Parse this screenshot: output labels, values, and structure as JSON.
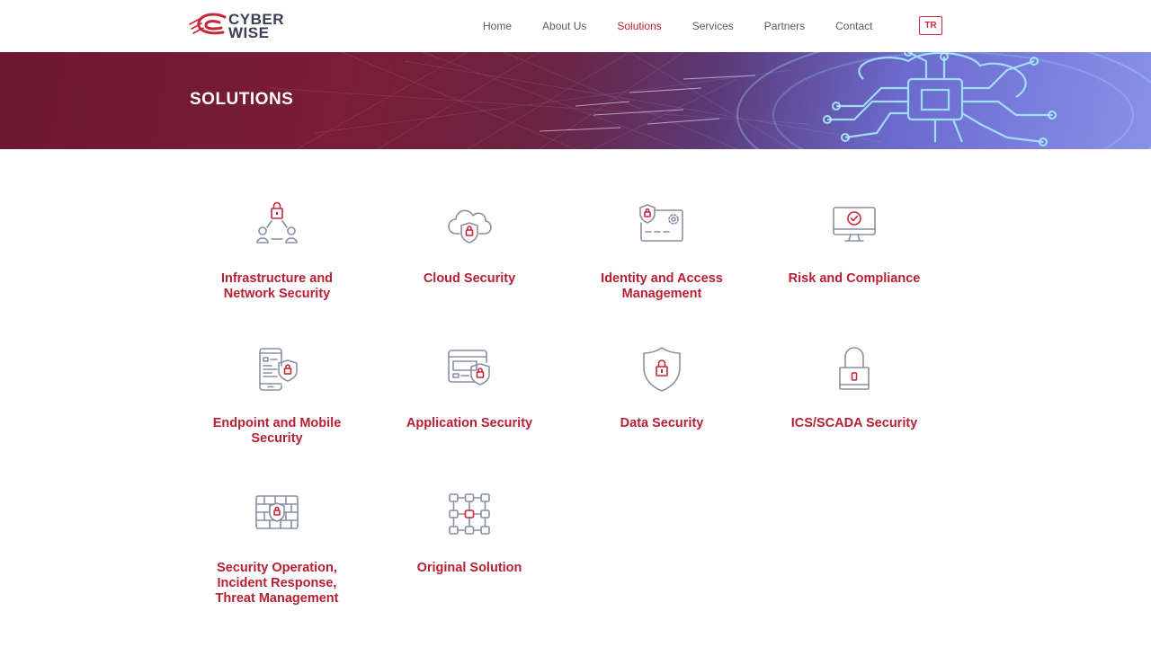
{
  "brand": {
    "line1": "CYBER",
    "line2": "WISE"
  },
  "nav": {
    "items": [
      {
        "label": "Home",
        "active": false
      },
      {
        "label": "About Us",
        "active": false
      },
      {
        "label": "Solutions",
        "active": true
      },
      {
        "label": "Services",
        "active": false
      },
      {
        "label": "Partners",
        "active": false
      },
      {
        "label": "Contact",
        "active": false
      }
    ],
    "language": "TR"
  },
  "banner": {
    "title": "SOLUTIONS"
  },
  "solutions": [
    {
      "label": "Infrastructure and Network Security",
      "icon": "network-lock-icon"
    },
    {
      "label": "Cloud Security",
      "icon": "cloud-shield-icon"
    },
    {
      "label": "Identity and Access Management",
      "icon": "id-card-icon"
    },
    {
      "label": "Risk and Compliance",
      "icon": "monitor-check-icon"
    },
    {
      "label": "Endpoint and Mobile Security",
      "icon": "mobile-shield-icon"
    },
    {
      "label": "Application Security",
      "icon": "app-window-shield-icon"
    },
    {
      "label": "Data Security",
      "icon": "shield-lock-icon"
    },
    {
      "label": "ICS/SCADA Security",
      "icon": "padlock-icon"
    },
    {
      "label": "Security Operation, Incident Response, Threat Management",
      "icon": "firewall-lock-icon"
    },
    {
      "label": "Original Solution",
      "icon": "node-grid-icon"
    }
  ],
  "colors": {
    "accent": "#b72034",
    "icon_gray": "#8a8fa3",
    "icon_red": "#c8273a",
    "text_gray": "#555a66"
  }
}
